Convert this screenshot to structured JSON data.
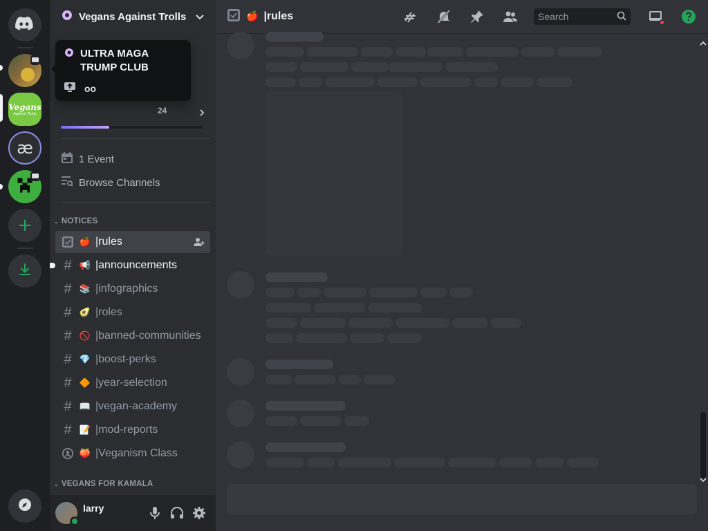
{
  "rail": {
    "servers": [
      {
        "name": "home",
        "icon": "discord-logo-icon"
      },
      {
        "name": "server-ultra-maga",
        "icon": "server-avatar"
      },
      {
        "name": "server-vegans-against-trolls",
        "label": "Vegans",
        "sub": "Against Trolls"
      },
      {
        "name": "server-ae",
        "label": "æ"
      },
      {
        "name": "server-creeper",
        "icon": "creeper-icon"
      },
      {
        "name": "add-server",
        "icon": "plus-icon"
      },
      {
        "name": "download-apps",
        "icon": "download-icon"
      },
      {
        "name": "explore",
        "icon": "compass-icon"
      }
    ]
  },
  "guild": {
    "name": "Vegans Against Trolls",
    "boost_count": "24",
    "boost_progress": 0.34
  },
  "tooltip": {
    "title": "ULTRA MAGA TRUMP CLUB",
    "voice_label": "oo"
  },
  "side_links": {
    "events": "1 Event",
    "browse": "Browse Channels"
  },
  "categories": {
    "notices": "NOTICES",
    "vegans_for_kamala": "VEGANS FOR KAMALA"
  },
  "channels": [
    {
      "name": "|rules",
      "emoji": "🍎",
      "type": "rules",
      "active": true
    },
    {
      "name": "|announcements",
      "emoji": "📢",
      "type": "text",
      "unread": true
    },
    {
      "name": "|infographics",
      "emoji": "📚",
      "type": "text"
    },
    {
      "name": "|roles",
      "emoji": "🥑",
      "type": "text"
    },
    {
      "name": "|banned-communities",
      "emoji": "🚫",
      "type": "text"
    },
    {
      "name": "|boost-perks",
      "emoji": "💎",
      "type": "text"
    },
    {
      "name": "|year-selection",
      "emoji": "🔶",
      "type": "text"
    },
    {
      "name": "|vegan-academy",
      "emoji": "📖",
      "type": "text"
    },
    {
      "name": "|mod-reports",
      "emoji": "📝",
      "type": "text"
    },
    {
      "name": "|Veganism Class",
      "emoji": "🍑",
      "type": "stage"
    }
  ],
  "user": {
    "name": "larry",
    "status": "online"
  },
  "header": {
    "channel": "|rules",
    "emoji": "🍎",
    "search_placeholder": "Search"
  },
  "colors": {
    "bg_main": "#313338",
    "bg_sidebar": "#2b2d31",
    "bg_rail": "#1e1f22",
    "online": "#23a55a",
    "help": "#23a55a",
    "accent": "#5865f2"
  }
}
